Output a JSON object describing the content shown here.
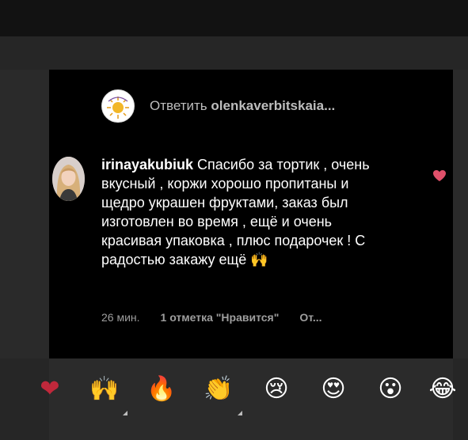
{
  "reply": {
    "prefix": "Ответить",
    "username": "olenkaverbitskaia..."
  },
  "comment": {
    "username": "irinayakubiuk",
    "text": " Спасибо за тортик , очень вкусный , коржи хорошо пропитаны и щедро украшен фруктами, заказ был изготовлен во время , ещё и очень красивая упаковка , плюс подарочек ! С радостью закажу ещё 🙌",
    "time": "26 мин.",
    "likes": "1 отметка \"Нравится\"",
    "reply_short": "От..."
  },
  "emoji_bar": {
    "items": [
      {
        "name": "heart",
        "glyph": "❤"
      },
      {
        "name": "raising-hands",
        "glyph": "🙌"
      },
      {
        "name": "fire",
        "glyph": "🔥"
      },
      {
        "name": "clapping-hands",
        "glyph": "👏"
      },
      {
        "name": "crying-face",
        "glyph": "😢"
      },
      {
        "name": "heart-eyes",
        "glyph": "😍"
      },
      {
        "name": "surprised-face",
        "glyph": "😮"
      },
      {
        "name": "laughing-face",
        "glyph": "😂"
      }
    ]
  },
  "colors": {
    "card": "#000000",
    "backdrop": "#262626",
    "heart": "#e0506a",
    "muted": "#9e9e9e"
  }
}
